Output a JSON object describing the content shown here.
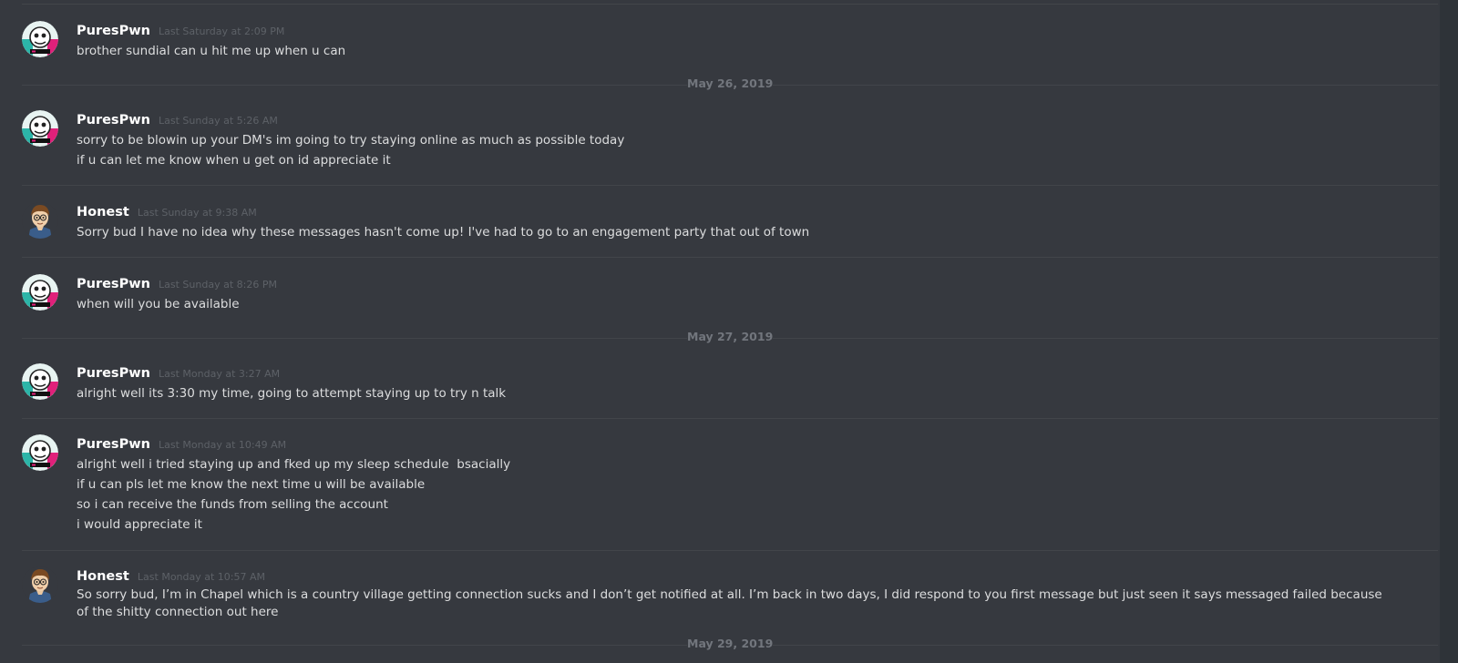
{
  "messages": [
    {
      "author": "PuresPwn",
      "avatar": "skull-badge-avatar",
      "timestamp": "Last Saturday at 2:09 PM",
      "lines": [
        "brother sundial can u hit me up when u can"
      ]
    },
    {
      "author": "PuresPwn",
      "avatar": "skull-badge-avatar",
      "timestamp": "Last Sunday at 5:26 AM",
      "lines": [
        "sorry to be blowin up your DM's im going to try staying online as much as possible today",
        "if u can let me know when u get on id appreciate it"
      ]
    },
    {
      "author": "Honest",
      "avatar": "cartoon-boy-avatar",
      "timestamp": "Last Sunday at 9:38 AM",
      "lines": [
        "Sorry bud I have no idea why these messages hasn't come up! I've had to go to an engagement party that out of town"
      ]
    },
    {
      "author": "PuresPwn",
      "avatar": "skull-badge-avatar",
      "timestamp": "Last Sunday at 8:26 PM",
      "lines": [
        "when will you be available"
      ]
    },
    {
      "author": "PuresPwn",
      "avatar": "skull-badge-avatar",
      "timestamp": "Last Monday at 3:27 AM",
      "lines": [
        "alright well its 3:30 my time, going to attempt staying up to try n talk"
      ]
    },
    {
      "author": "PuresPwn",
      "avatar": "skull-badge-avatar",
      "timestamp": "Last Monday at 10:49 AM",
      "lines": [
        "alright well i tried staying up and fked up my sleep schedule  bsacially",
        "if u can pls let me know the next time u will be available",
        "so i can receive the funds from selling the account",
        "i would appreciate it"
      ]
    },
    {
      "author": "Honest",
      "avatar": "cartoon-boy-avatar",
      "timestamp": "Last Monday at 10:57 AM",
      "lines": [
        "So sorry bud, I’m in Chapel which is a country village getting connection sucks and I don’t get notified at all. I’m back in two days, I did respond to you first message but just seen it says messaged failed because of the shitty connection out here"
      ]
    }
  ],
  "date_dividers": [
    "May 26, 2019",
    "May 27, 2019",
    "May 29, 2019"
  ],
  "colors": {
    "background": "#36393f",
    "username": "#ffffff",
    "message_text": "#dcddde",
    "timestamp": "#5d6167",
    "divider": "#42454a"
  }
}
